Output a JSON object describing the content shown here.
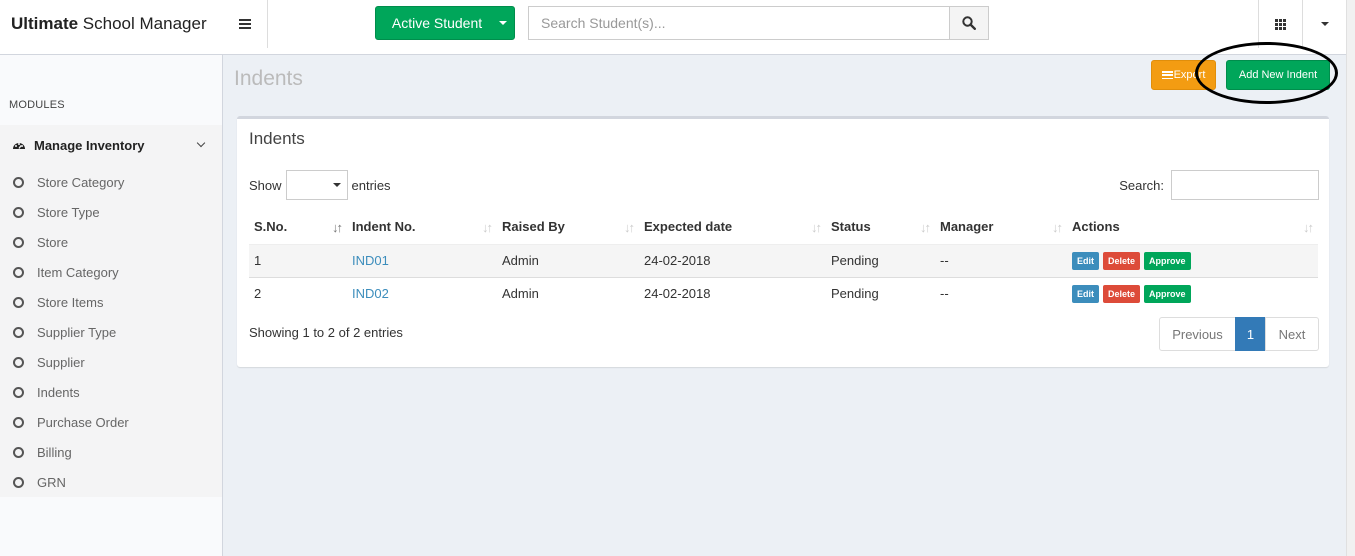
{
  "app": {
    "brand_bold": "Ultimate",
    "brand_rest": " School Manager"
  },
  "topbar": {
    "active_student_label": "Active Student",
    "search_placeholder": "Search Student(s)..."
  },
  "sidebar": {
    "modules_header": "MODULES",
    "group_label": "Manage Inventory",
    "items": [
      {
        "label": "Store Category"
      },
      {
        "label": "Store Type"
      },
      {
        "label": "Store"
      },
      {
        "label": "Item Category"
      },
      {
        "label": "Store Items"
      },
      {
        "label": "Supplier Type"
      },
      {
        "label": "Supplier"
      },
      {
        "label": "Indents"
      },
      {
        "label": "Purchase Order"
      },
      {
        "label": "Billing"
      },
      {
        "label": "GRN"
      }
    ]
  },
  "page": {
    "title": "Indents",
    "export_label": "Export",
    "add_label": "Add New Indent"
  },
  "box": {
    "title": "Indents",
    "show_label": "Show",
    "entries_label": "entries",
    "search_label": "Search:",
    "columns": [
      "S.No.",
      "Indent No.",
      "Raised By",
      "Expected date",
      "Status",
      "Manager",
      "Actions"
    ],
    "rows": [
      {
        "sno": "1",
        "indent_no": "IND01",
        "raised_by": "Admin",
        "expected_date": "24-02-2018",
        "status": "Pending",
        "manager": "--"
      },
      {
        "sno": "2",
        "indent_no": "IND02",
        "raised_by": "Admin",
        "expected_date": "24-02-2018",
        "status": "Pending",
        "manager": "--"
      }
    ],
    "actions": {
      "edit": "Edit",
      "delete": "Delete",
      "approve": "Approve"
    },
    "info": "Showing 1 to 2 of 2 entries",
    "pager": {
      "previous": "Previous",
      "current": "1",
      "next": "Next"
    }
  },
  "colors": {
    "green": "#00a65a",
    "orange": "#f39c12",
    "blue": "#3c8dbc",
    "red": "#dd4b39"
  }
}
